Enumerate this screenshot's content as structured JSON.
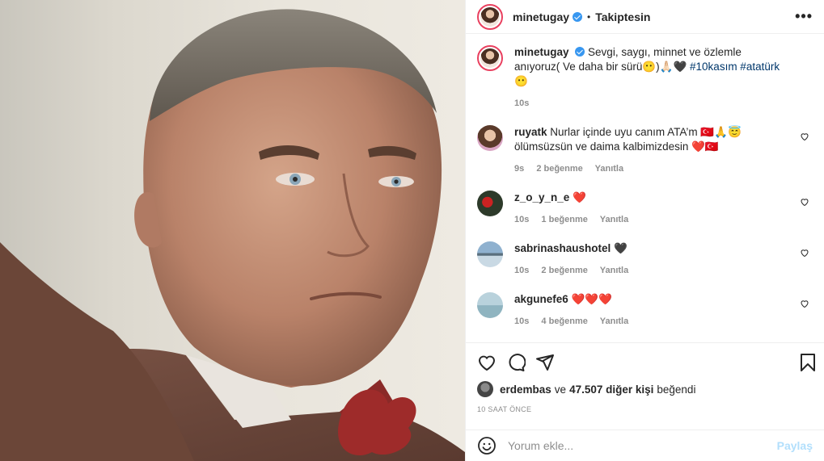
{
  "header": {
    "username": "minetugay",
    "follow_label": "Takiptesin",
    "dot": "•",
    "more": "•••"
  },
  "caption": {
    "username": "minetugay",
    "text": "Sevgi, saygı, minnet ve özlemle anıyoruz( Ve daha bir sürü😶)🙏🏻🖤",
    "hashtags": "#10kasım #atatürk",
    "trailing": "😶",
    "time": "10s"
  },
  "comments": [
    {
      "username": "ruyatk",
      "text": "Nurlar içinde uyu canım ATA’m 🇹🇷🙏😇ölümsüzsün ve daima kalbimizdesin ❤️🇹🇷",
      "time": "9s",
      "likes": "2 beğenme",
      "reply": "Yanıtla"
    },
    {
      "username": "z_o_y_n_e",
      "text": "❤️",
      "time": "10s",
      "likes": "1 beğenme",
      "reply": "Yanıtla"
    },
    {
      "username": "sabrinashaushotel",
      "text": "🖤",
      "time": "10s",
      "likes": "2 beğenme",
      "reply": "Yanıtla"
    },
    {
      "username": "akgunefe6",
      "text": "❤️❤️❤️",
      "time": "10s",
      "likes": "4 beğenme",
      "reply": "Yanıtla"
    }
  ],
  "likes": {
    "user": "erdembas",
    "and": "ve",
    "count": "47.507 diğer kişi",
    "suffix": "beğendi"
  },
  "post_time": "10 SAAT ÖNCE",
  "comment_box": {
    "placeholder": "Yorum ekle...",
    "post_label": "Paylaş"
  },
  "icons": {
    "like": "heart-icon",
    "comment": "comment-icon",
    "share": "share-icon",
    "save": "bookmark-icon",
    "emoji": "emoji-icon",
    "more": "more-icon",
    "verified": "verified-badge-icon"
  },
  "colors": {
    "verified": "#3897f0",
    "link": "#00376b",
    "muted": "#8e8e8e",
    "post_button": "#b2dffc",
    "story_ring": "#e9405f"
  }
}
